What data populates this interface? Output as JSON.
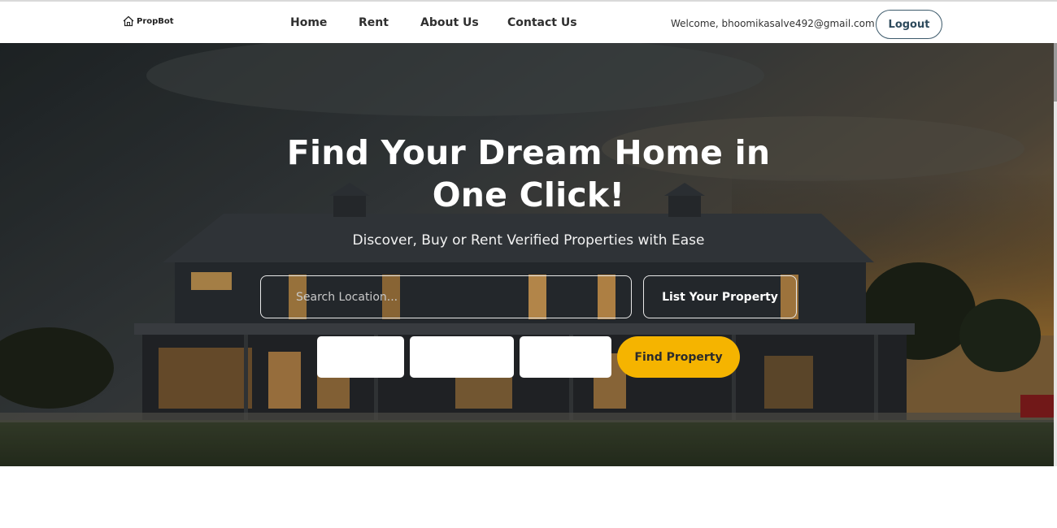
{
  "navbar": {
    "brand": {
      "name": "PropBot",
      "icon": "house-icon"
    },
    "links": [
      {
        "label": "Home"
      },
      {
        "label": "Rent"
      },
      {
        "label": "About Us"
      },
      {
        "label": "Contact Us"
      }
    ],
    "welcome_text": "Welcome, bhoomikasalve492@gmail.com",
    "logout_label": "Logout"
  },
  "hero": {
    "title": "Find Your Dream Home in One Click!",
    "subtitle": "Discover, Buy or Rent Verified Properties with Ease",
    "search": {
      "placeholder": "Search Location...",
      "value": ""
    },
    "list_property_label": "List Your Property",
    "filters": [
      {
        "name": "filter-1",
        "value": ""
      },
      {
        "name": "filter-2",
        "value": ""
      },
      {
        "name": "filter-3",
        "value": ""
      }
    ],
    "find_label": "Find Property"
  },
  "colors": {
    "accent": "#f5b400",
    "logout_border": "#3d5a6b",
    "nav_text": "#2f2f2f"
  }
}
